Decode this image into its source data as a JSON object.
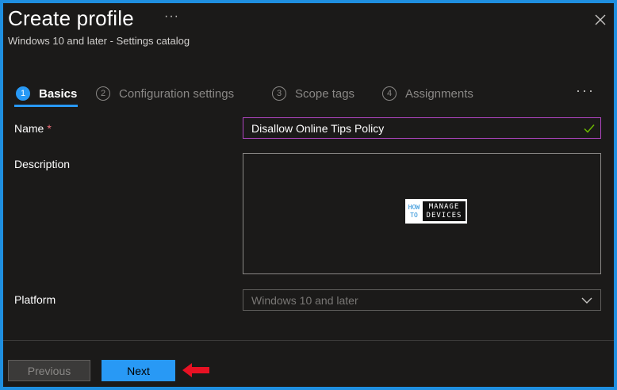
{
  "header": {
    "title": "Create profile",
    "more": "···",
    "subtitle": "Windows 10 and later - Settings catalog",
    "close_icon": "close-icon"
  },
  "tabs": [
    {
      "number": "1",
      "label": "Basics",
      "active": true
    },
    {
      "number": "2",
      "label": "Configuration settings",
      "active": false
    },
    {
      "number": "3",
      "label": "Scope tags",
      "active": false
    },
    {
      "number": "4",
      "label": "Assignments",
      "active": false
    }
  ],
  "tabs_more": "···",
  "form": {
    "name_label": "Name",
    "required_marker": "*",
    "name_value": "Disallow Online Tips Policy",
    "description_label": "Description",
    "description_value": "",
    "platform_label": "Platform",
    "platform_value": "Windows 10 and later"
  },
  "watermark": {
    "how_top": "HOW",
    "how_bottom": "TO",
    "line1": "MANAGE",
    "line2": "DEVICES"
  },
  "footer": {
    "previous_label": "Previous",
    "next_label": "Next"
  },
  "colors": {
    "accent": "#2899f5",
    "focus_border": "#b146c2",
    "required": "#f1707b",
    "arrow": "#e81123",
    "valid_check": "#6bb700"
  }
}
